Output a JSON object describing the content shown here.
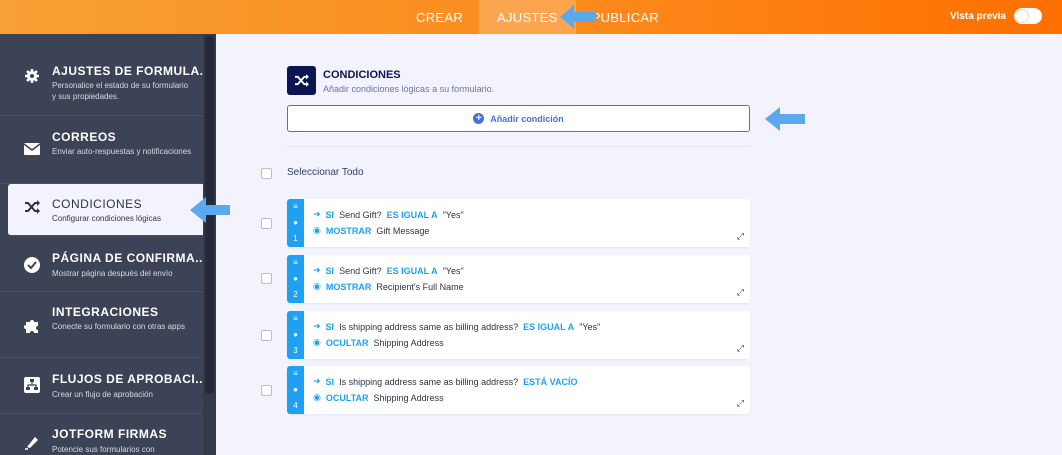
{
  "topbar": {
    "tabs": [
      {
        "label": "CREAR"
      },
      {
        "label": "AJUSTES"
      },
      {
        "label": "PUBLICAR"
      }
    ],
    "preview_label": "Vista previa"
  },
  "sidebar": {
    "items": [
      {
        "icon": "gear-icon",
        "title": "AJUSTES DE FORMULA...",
        "desc": "Personalice el estado de su formulario y sus propiedades."
      },
      {
        "icon": "envelope-icon",
        "title": "CORREOS",
        "desc": "Enviar auto-respuestas y notificaciones"
      },
      {
        "icon": "shuffle-icon",
        "title": "CONDICIONES",
        "desc": "Configurar condiciones lógicas"
      },
      {
        "icon": "check-circle-icon",
        "title": "PÁGINA DE CONFIRMA...",
        "desc": "Mostrar página después del envío"
      },
      {
        "icon": "puzzle-icon",
        "title": "INTEGRACIONES",
        "desc": "Conecte su formulario con otras apps"
      },
      {
        "icon": "approval-flow-icon",
        "title": "FLUJOS DE APROBACI...",
        "desc": "Crear un flujo de aprobación"
      },
      {
        "icon": "pen-icon",
        "title": "JOTFORM FIRMAS",
        "desc": "Potencie sus formularios con"
      }
    ]
  },
  "main": {
    "title": "CONDICIONES",
    "subtitle": "Añadir condiciones lógicas a su formulario.",
    "add_button": "Añadir condición",
    "select_all": "Seleccionar Todo",
    "conditions": [
      {
        "num": "1",
        "if": "SI",
        "field": "Send Gift?",
        "op": "ES IGUAL A",
        "value": "\"Yes\"",
        "action": "MOSTRAR",
        "target": "Gift Message"
      },
      {
        "num": "2",
        "if": "SI",
        "field": "Send Gift?",
        "op": "ES IGUAL A",
        "value": "\"Yes\"",
        "action": "MOSTRAR",
        "target": "Recipient's Full Name"
      },
      {
        "num": "3",
        "if": "SI",
        "field": "Is shipping address same as billing address?",
        "op": "ES IGUAL A",
        "value": "\"Yes\"",
        "action": "OCULTAR",
        "target": "Shipping Address"
      },
      {
        "num": "4",
        "if": "SI",
        "field": "Is shipping address same as billing address?",
        "op": "ESTÁ VACÍO",
        "value": "",
        "action": "OCULTAR",
        "target": "Shipping Address"
      }
    ]
  },
  "colors": {
    "accent": "#4573d2",
    "condition_blue": "#1ea1f2",
    "sidebar_bg": "#3d4356",
    "topbar_orange": "#fb8a1c",
    "annotation_arrow": "#5aa9ef"
  }
}
